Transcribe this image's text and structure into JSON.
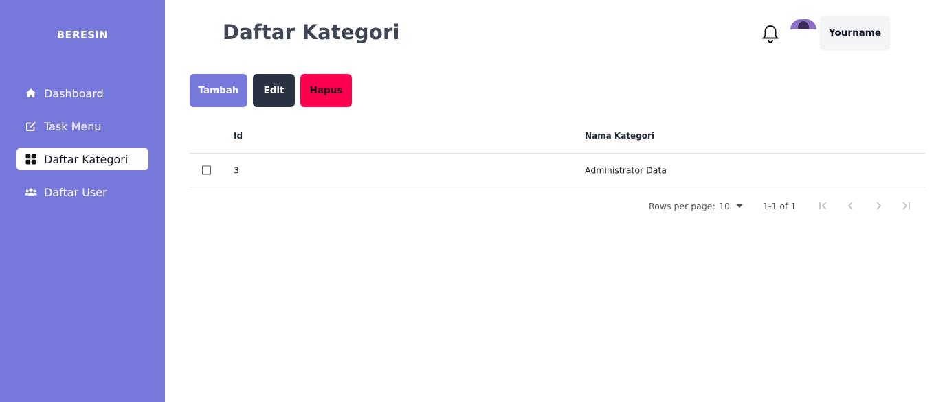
{
  "sidebar": {
    "brand": "BERESIN",
    "items": [
      {
        "label": "Dashboard",
        "icon": "home-icon"
      },
      {
        "label": "Task Menu",
        "icon": "edit-icon"
      },
      {
        "label": "Daftar Kategori",
        "icon": "grid-icon",
        "active": true
      },
      {
        "label": "Daftar User",
        "icon": "users-icon"
      }
    ]
  },
  "header": {
    "title": "Daftar Kategori",
    "user_label": "Yourname",
    "icons": [
      "bell-icon",
      "avatar"
    ]
  },
  "toolbar": {
    "tambah_label": "Tambah",
    "edit_label": "Edit",
    "hapus_label": "Hapus"
  },
  "table": {
    "columns": [
      "Id",
      "Nama Kategori"
    ],
    "rows": [
      {
        "id": "3",
        "nama": "Administrator Data"
      }
    ]
  },
  "pagination": {
    "rows_per_page_label": "Rows per page:",
    "rows_per_page_value": "10",
    "range": "1-1 of 1"
  },
  "colors": {
    "sidebar": "#7678dc",
    "tambah": "#7678dc",
    "edit": "#2a3142",
    "hapus": "#ff0050",
    "title": "#3f4656"
  }
}
